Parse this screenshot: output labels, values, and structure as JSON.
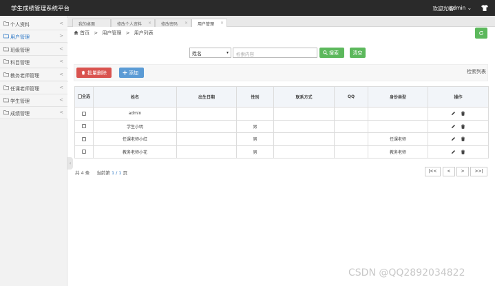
{
  "app": {
    "title": "学生成绩管理系统平台",
    "welcome": "欢迎光临:",
    "username": "admin",
    "user_caret": "⌄"
  },
  "sidebar": {
    "items": [
      {
        "label": "个人资料",
        "arrow": "<"
      },
      {
        "label": "用户管理",
        "arrow": ">",
        "active": true
      },
      {
        "label": "班级管理",
        "arrow": "<"
      },
      {
        "label": "科目管理",
        "arrow": "<"
      },
      {
        "label": "教务老师管理",
        "arrow": "<"
      },
      {
        "label": "任课老师管理",
        "arrow": "<"
      },
      {
        "label": "学生管理",
        "arrow": "<"
      },
      {
        "label": "成绩管理",
        "arrow": "<"
      }
    ],
    "collapse": "‹"
  },
  "tabs": [
    {
      "label": "我的桌面",
      "closable": false
    },
    {
      "label": "修改个人资料",
      "closable": true
    },
    {
      "label": "修改密码",
      "closable": true
    },
    {
      "label": "用户管理",
      "closable": true,
      "active": true
    }
  ],
  "tab_close": "×",
  "breadcrumb": {
    "home": "首页",
    "sep": ">",
    "level1": "用户管理",
    "level2": "用户列表"
  },
  "search": {
    "select_value": "姓名",
    "select_caret": "▾",
    "input_placeholder": "检索内容",
    "search_label": "搜索",
    "clear_label": "清空"
  },
  "toolbar": {
    "batch_delete_label": "批量删除",
    "add_label": "添加",
    "search_list_label": "检索列表"
  },
  "table": {
    "headers": {
      "select_all": "全选",
      "name": "姓名",
      "birth": "出生日期",
      "gender": "性别",
      "contact": "联系方式",
      "qq": "QQ",
      "identity": "身份类型",
      "actions": "操作"
    },
    "rows": [
      {
        "name": "admin",
        "birth": "",
        "gender": "",
        "contact": "",
        "qq": "",
        "identity": ""
      },
      {
        "name": "学生小明",
        "birth": "",
        "gender": "男",
        "contact": "",
        "qq": "",
        "identity": ""
      },
      {
        "name": "任课老师小红",
        "birth": "",
        "gender": "男",
        "contact": "",
        "qq": "",
        "identity": "任课老师"
      },
      {
        "name": "教务老师小花",
        "birth": "",
        "gender": "男",
        "contact": "",
        "qq": "",
        "identity": "教务老师"
      }
    ]
  },
  "pagination": {
    "total_prefix": "共",
    "total": "4",
    "total_suffix": "条",
    "current_label": "当前第",
    "current": "1 / 1",
    "page_suffix": "页",
    "first": "|<<",
    "prev": "<",
    "next": ">",
    "last": ">>|"
  },
  "watermark": "CSDN @QQ2892034822",
  "colors": {
    "topbar": "#2a2a2a",
    "success": "#5cb85c",
    "danger": "#d9534f",
    "primary": "#5b9bd5",
    "link": "#2c77c6"
  }
}
